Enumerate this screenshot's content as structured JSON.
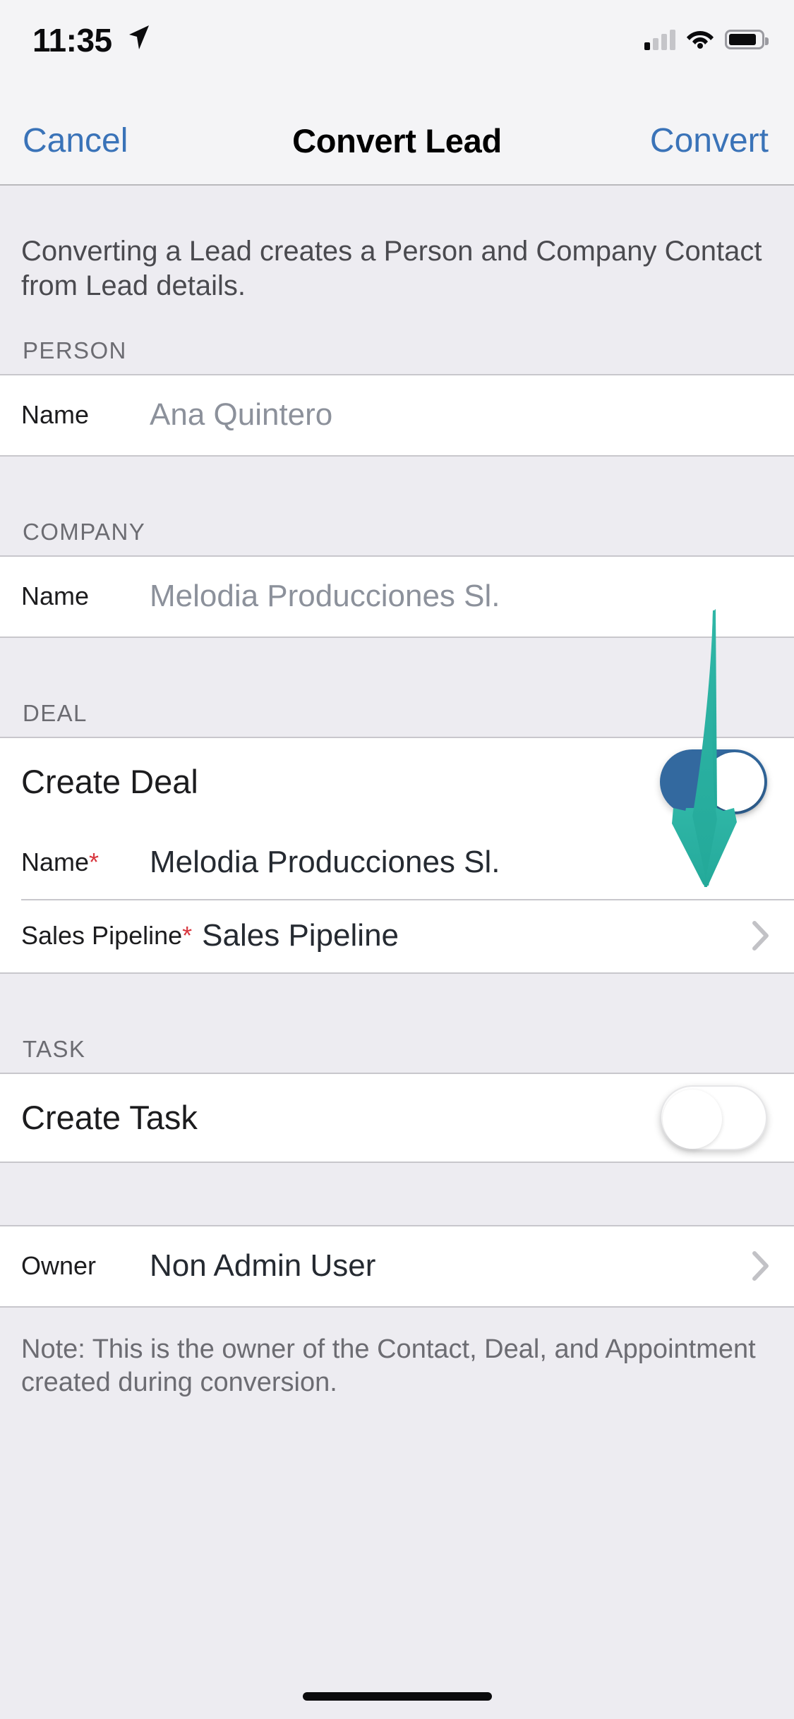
{
  "status_bar": {
    "time": "11:35",
    "location_icon": "location-arrow-icon",
    "signal_icon": "cellular-signal-icon",
    "wifi_icon": "wifi-icon",
    "battery_icon": "battery-icon"
  },
  "nav": {
    "cancel_label": "Cancel",
    "title": "Convert Lead",
    "confirm_label": "Convert"
  },
  "intro_text": "Converting a Lead creates a Person and Company Contact from Lead details.",
  "sections": {
    "person": {
      "header": "PERSON",
      "name_label": "Name",
      "name_value": "Ana Quintero"
    },
    "company": {
      "header": "COMPANY",
      "name_label": "Name",
      "name_value": "Melodia Producciones Sl."
    },
    "deal": {
      "header": "DEAL",
      "create_label": "Create Deal",
      "create_enabled": "on",
      "name_label": "Name",
      "name_required": "*",
      "name_value": "Melodia Producciones Sl.",
      "pipeline_label": "Sales Pipeline",
      "pipeline_required": "*",
      "pipeline_value": "Sales Pipeline"
    },
    "task": {
      "header": "TASK",
      "create_label": "Create Task",
      "create_enabled": "off"
    },
    "owner": {
      "label": "Owner",
      "value": "Non Admin User",
      "note": "Note: This is the owner of the Contact, Deal, and Appointment created during conversion."
    }
  },
  "colors": {
    "accent_blue": "#3A73B8",
    "toggle_on": "#33699F",
    "required_red": "#D8373F",
    "annotation_teal": "#2BB3A3",
    "group_bg": "#FFFFFF",
    "page_bg": "#EDECF1",
    "chrome_bg": "#F4F4F6"
  },
  "annotation": {
    "type": "arrow",
    "icon": "down-arrow-annotation",
    "points_to": "Create Deal toggle"
  },
  "home_indicator": "home-indicator"
}
